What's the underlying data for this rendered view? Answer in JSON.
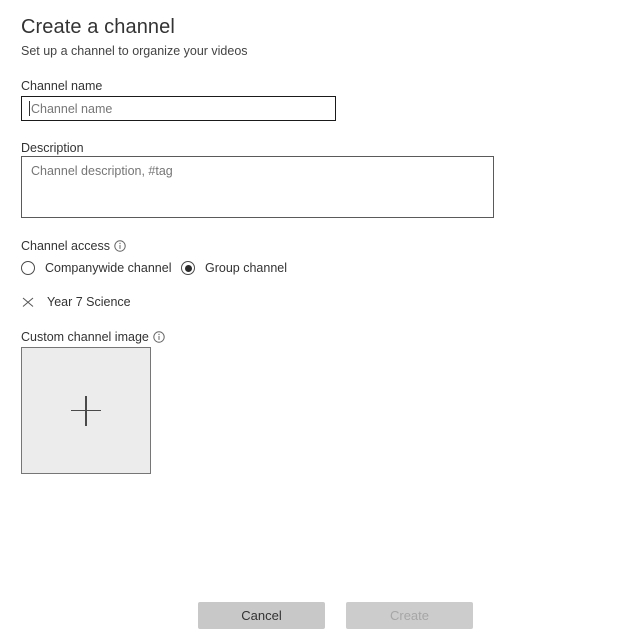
{
  "dialog": {
    "title": "Create a channel",
    "subtitle": "Set up a channel to organize your videos"
  },
  "fields": {
    "channel_name": {
      "label": "Channel name",
      "placeholder": "Channel name",
      "value": ""
    },
    "description": {
      "label": "Description",
      "placeholder": "Channel description, #tag",
      "value": ""
    },
    "channel_access": {
      "label": "Channel access",
      "info_icon": "info-icon",
      "options": [
        {
          "label": "Companywide channel",
          "selected": false
        },
        {
          "label": "Group channel",
          "selected": true
        }
      ]
    },
    "selected_group": {
      "name": "Year 7 Science",
      "remove_icon": "close-icon"
    },
    "custom_channel_image": {
      "label": "Custom channel image",
      "info_icon": "info-icon",
      "add_icon": "plus-icon"
    }
  },
  "footer": {
    "cancel_label": "Cancel",
    "create_label": "Create",
    "create_disabled": true
  },
  "colors": {
    "text": "#333333",
    "placeholder": "#767676",
    "input_border_focused": "#1a1a1a",
    "input_border": "#5a5a5a",
    "button_neutral": "#c8c8c8",
    "button_disabled_bg": "#cccccc",
    "button_disabled_text": "#a6a6a6",
    "image_placeholder_bg": "#ececec"
  }
}
